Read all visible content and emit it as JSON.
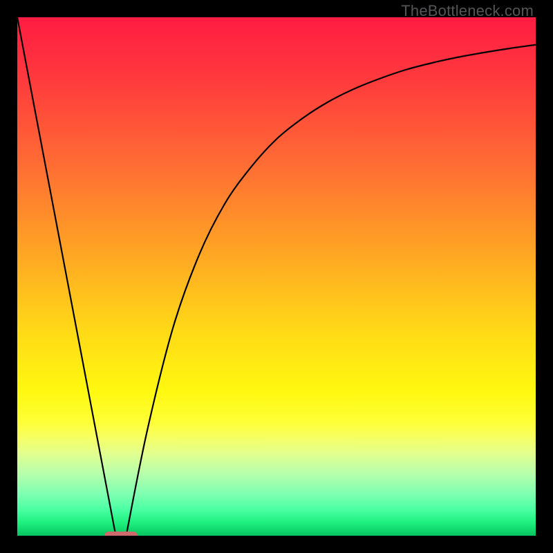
{
  "watermark": "TheBottleneck.com",
  "chart_data": {
    "type": "line",
    "title": "",
    "xlabel": "",
    "ylabel": "",
    "xlim": [
      0,
      100
    ],
    "ylim": [
      0,
      100
    ],
    "grid": false,
    "series": [
      {
        "name": "left-branch",
        "x": [
          0,
          19
        ],
        "y": [
          100,
          0
        ],
        "style": "straight"
      },
      {
        "name": "right-branch",
        "x": [
          21,
          25,
          30,
          35,
          40,
          45,
          50,
          55,
          60,
          65,
          70,
          75,
          80,
          85,
          90,
          95,
          100
        ],
        "y": [
          0,
          20,
          40,
          54,
          64,
          71,
          76.5,
          80.5,
          83.7,
          86.2,
          88.2,
          89.9,
          91.2,
          92.3,
          93.2,
          94,
          94.7
        ],
        "style": "smooth"
      }
    ],
    "annotations": [
      {
        "name": "optimal-marker",
        "x_center": 20,
        "y": 0,
        "width_pct": 6.5,
        "height_pct": 1.6
      }
    ],
    "gradient_stops": [
      {
        "pct": 0,
        "color": "#ff1c42"
      },
      {
        "pct": 12,
        "color": "#ff3a3d"
      },
      {
        "pct": 28,
        "color": "#ff6b34"
      },
      {
        "pct": 45,
        "color": "#ffa424"
      },
      {
        "pct": 60,
        "color": "#ffd817"
      },
      {
        "pct": 72,
        "color": "#fff80f"
      },
      {
        "pct": 78,
        "color": "#feff36"
      },
      {
        "pct": 81,
        "color": "#f7ff62"
      },
      {
        "pct": 84,
        "color": "#e3ff8d"
      },
      {
        "pct": 88,
        "color": "#b7ffab"
      },
      {
        "pct": 92,
        "color": "#7effb2"
      },
      {
        "pct": 95,
        "color": "#49ffa2"
      },
      {
        "pct": 97.5,
        "color": "#1ef07f"
      },
      {
        "pct": 100,
        "color": "#06c45e"
      }
    ]
  }
}
